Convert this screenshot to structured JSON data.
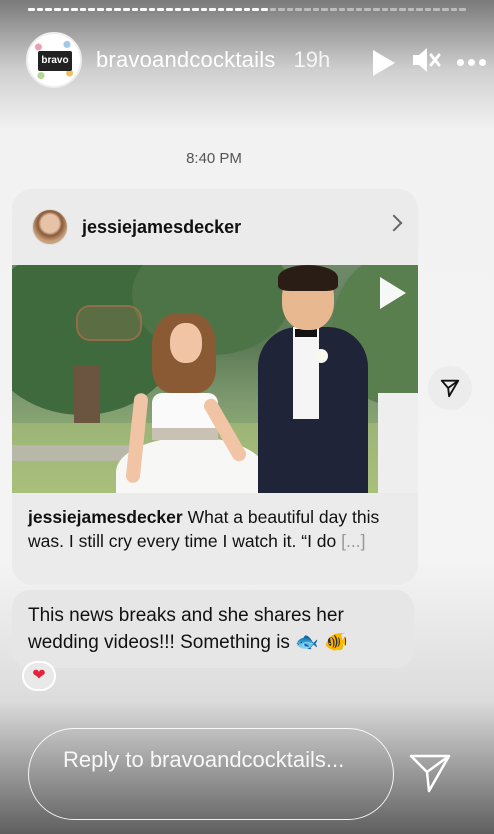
{
  "story": {
    "account": "bravoandcocktails",
    "time_ago": "19h",
    "avatar_logo_text": "bravo"
  },
  "dm": {
    "timestamp": "8:40 PM",
    "shared_post": {
      "author": "jessiejamesdecker",
      "caption_author": "jessiejamesdecker",
      "caption_text": " What a beautiful day this was. I still cry every time I watch it. “I do ",
      "caption_more": "[...]"
    },
    "message": "This news breaks and she shares her wedding videos!!! Something is 🐟 🐠",
    "reaction": "❤"
  },
  "reply": {
    "placeholder": "Reply to bravoandcocktails..."
  },
  "icons": {
    "play": "play-icon",
    "mute": "mute-icon",
    "more": "more-icon",
    "share": "share-icon",
    "send": "send-icon",
    "chevron": "chevron-right-icon"
  },
  "colors": {
    "heart": "#e8213a",
    "bubble": "#e6e6e6"
  }
}
